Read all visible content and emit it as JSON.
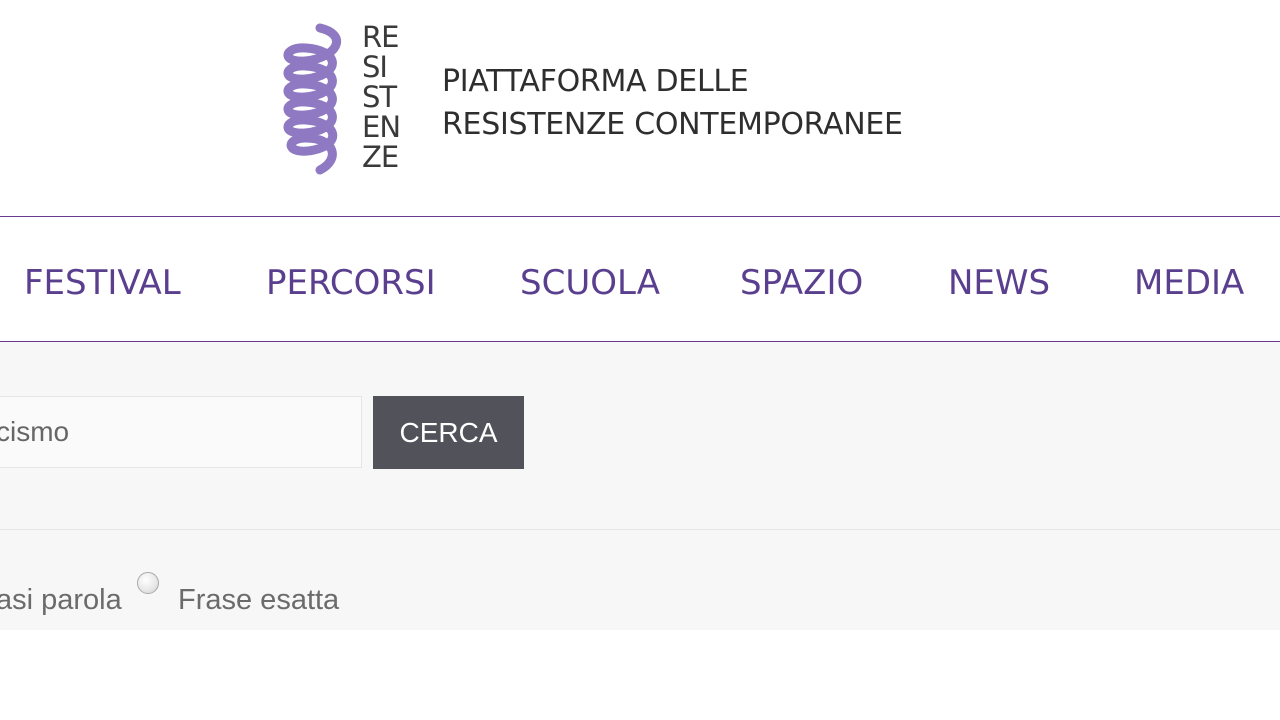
{
  "header": {
    "logo_letters": [
      "RE",
      "SI",
      "ST",
      "EN",
      "ZE"
    ],
    "tagline_line1": "PIATTAFORMA DELLE",
    "tagline_line2": "RESISTENZE CONTEMPORANEE",
    "brand_color": "#8e79c2"
  },
  "nav": {
    "items": [
      {
        "label": "FESTIVAL"
      },
      {
        "label": "PERCORSI"
      },
      {
        "label": "SCUOLA"
      },
      {
        "label": "SPAZIO"
      },
      {
        "label": "NEWS"
      },
      {
        "label": "MEDIA"
      }
    ],
    "color": "#5b3f8f"
  },
  "search": {
    "input_value": "cismo",
    "button_label": "CERCA",
    "options": {
      "any_word_label": "asi parola",
      "exact_phrase_label": "Frase esatta"
    }
  }
}
